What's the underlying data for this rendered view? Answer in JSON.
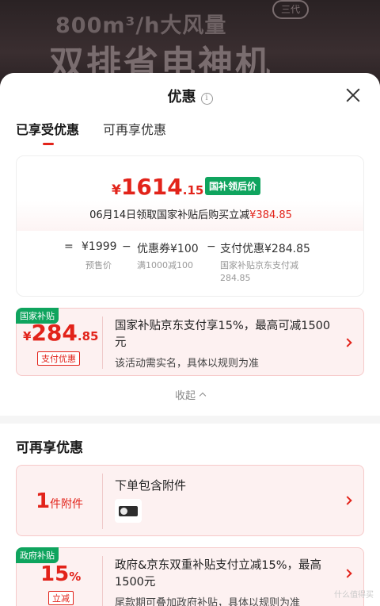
{
  "banner": {
    "line1": "800m³/h大风量",
    "line2": "双排省电神机",
    "badge": "三代"
  },
  "header": {
    "title": "优惠",
    "info_glyph": "i"
  },
  "tabs": [
    {
      "label": "已享受优惠"
    },
    {
      "label": "可再享优惠"
    }
  ],
  "price_card": {
    "yen": "¥",
    "price_int": "1614",
    "price_dec": ".15",
    "tag": "国补领后价",
    "subtitle_prefix": "06月14日领取国家补贴后购买立减",
    "subtitle_amount": "¥384.85",
    "formula": {
      "eq": "=",
      "presale": "¥1999",
      "minus1": "−",
      "coupon": "优惠券¥100",
      "minus2": "−",
      "pay": "支付优惠¥284.85",
      "presale_label": "预售价",
      "coupon_label": "满1000减100",
      "pay_label": "国家补贴京东支付减",
      "pay_label2": "284.85"
    }
  },
  "gov_card": {
    "tag": "国家补贴",
    "yen": "¥",
    "price_int": "284",
    "price_dec": ".85",
    "label": "支付优惠",
    "text": "国家补贴京东支付享15%，最高可减1500元",
    "note": "该活动需实名，具体以规则为准"
  },
  "collapse": {
    "label": "收起"
  },
  "more": {
    "title": "可再享优惠",
    "offer1": {
      "num": "1",
      "unit": "件附件",
      "title": "下单包含附件"
    },
    "offer2": {
      "tag": "政府补贴",
      "num": "15",
      "sym": "%",
      "label": "立减",
      "text": "政府&京东双重补贴支付立减15%，最高1500元",
      "note": "尾款期可叠加政府补贴，具体以规则为准"
    }
  },
  "watermark": "什么值得买"
}
